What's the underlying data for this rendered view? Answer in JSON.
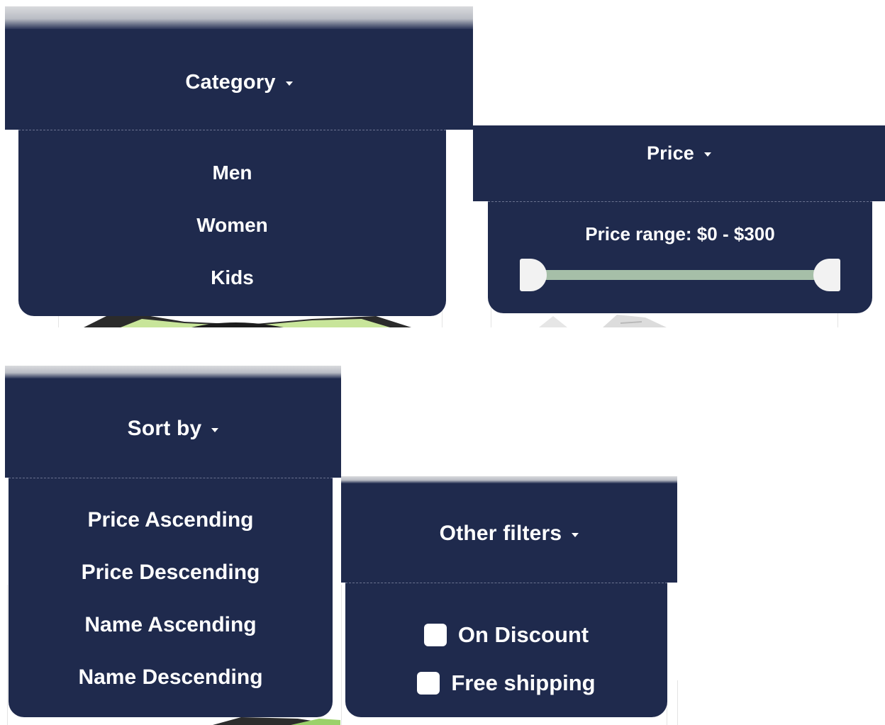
{
  "category_filter": {
    "label": "Category",
    "items": [
      "Men",
      "Women",
      "Kids"
    ]
  },
  "price_filter": {
    "label": "Price",
    "range_text": "Price range: $0 - $300",
    "min_value": 0,
    "max_value": 300,
    "slider_min_fraction": 0.0,
    "slider_max_fraction": 1.0
  },
  "sort_filter": {
    "label": "Sort by",
    "items": [
      "Price Ascending",
      "Price Descending",
      "Name Ascending",
      "Name Descending"
    ]
  },
  "other_filters": {
    "label": "Other filters",
    "options": [
      {
        "label": "On Discount",
        "checked": false
      },
      {
        "label": "Free shipping",
        "checked": false
      }
    ]
  },
  "colors": {
    "panel_bg": "#1f2a4d",
    "text": "#ffffff",
    "slider_track": "#a6bfa8",
    "slider_thumb": "#f2f2f2"
  }
}
